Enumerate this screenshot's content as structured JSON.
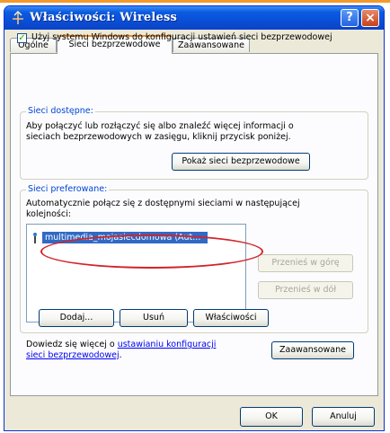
{
  "window": {
    "title": "Właściwości: Wireless",
    "help_glyph": "?",
    "close_glyph": "×"
  },
  "tabs": [
    {
      "label": "Ogólne",
      "active": false
    },
    {
      "label": "Sieci bezprzewodowe",
      "active": true
    },
    {
      "label": "Zaawansowane",
      "active": false
    }
  ],
  "wireless": {
    "use_windows_checked": true,
    "use_windows_label": "Użyj systemu Windows do konfiguracji ustawień sieci bezprzewodowej",
    "check_glyph": "✓"
  },
  "available": {
    "legend": "Sieci dostępne:",
    "description_line1": "Aby połączyć lub rozłączyć się albo znaleźć więcej informacji o",
    "description_line2": "sieciach bezprzewodowych w zasięgu, kliknij przycisk poniżej.",
    "show_button": "Pokaż sieci bezprzewodowe"
  },
  "preferred": {
    "legend": "Sieci preferowane:",
    "description_line1": "Automatycznie połącz się z dostępnymi sieciami w następującej",
    "description_line2": "kolejności:",
    "networks": [
      {
        "name": "multimedia_mojasiecdomowa (Aut...",
        "selected": true
      }
    ],
    "move_up_button": "Przenieś w górę",
    "move_down_button": "Przenieś w dół",
    "add_button": "Dodaj...",
    "remove_button": "Usuń",
    "properties_button": "Właściwości"
  },
  "learn_more": {
    "prefix": "Dowiedz się więcej o ",
    "link_line1": "ustawianiu konfiguracji",
    "link_line2": "sieci bezprzewodowej",
    "suffix": ".",
    "advanced_button": "Zaawansowane"
  },
  "footer": {
    "ok_button": "OK",
    "cancel_button": "Anuluj"
  },
  "colors": {
    "titlebar": "#0a4fd8",
    "selection": "#316ac5",
    "group_legend": "#0046d5",
    "highlight_ellipse": "#d2232a",
    "active_tab_accent": "#e68b2c"
  }
}
